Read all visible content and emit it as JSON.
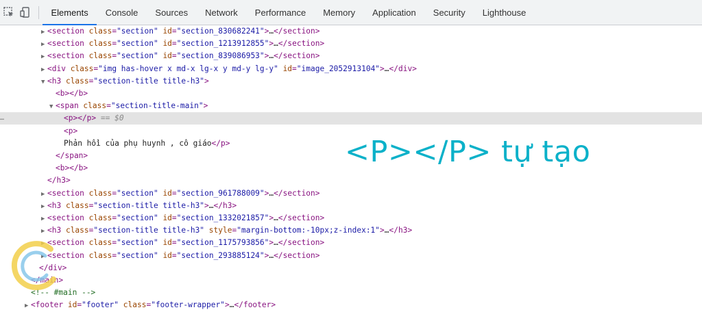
{
  "toolbar": {
    "tabs": [
      {
        "label": "Elements",
        "active": true
      },
      {
        "label": "Console"
      },
      {
        "label": "Sources"
      },
      {
        "label": "Network"
      },
      {
        "label": "Performance"
      },
      {
        "label": "Memory"
      },
      {
        "label": "Application"
      },
      {
        "label": "Security"
      },
      {
        "label": "Lighthouse"
      }
    ]
  },
  "tree": {
    "rows": [
      {
        "indent": 0,
        "arrow": "▶",
        "parts": [
          [
            "tag",
            "<section "
          ],
          [
            "attr",
            "class"
          ],
          [
            "tag",
            "="
          ],
          [
            "val",
            "\"section\""
          ],
          [
            "tag",
            " "
          ],
          [
            "attr",
            "id"
          ],
          [
            "tag",
            "="
          ],
          [
            "val",
            "\"section_830682241\""
          ],
          [
            "tag",
            ">"
          ],
          [
            "ell",
            "…"
          ],
          [
            "tag",
            "</section>"
          ]
        ]
      },
      {
        "indent": 0,
        "arrow": "▶",
        "parts": [
          [
            "tag",
            "<section "
          ],
          [
            "attr",
            "class"
          ],
          [
            "tag",
            "="
          ],
          [
            "val",
            "\"section\""
          ],
          [
            "tag",
            " "
          ],
          [
            "attr",
            "id"
          ],
          [
            "tag",
            "="
          ],
          [
            "val",
            "\"section_1213912855\""
          ],
          [
            "tag",
            ">"
          ],
          [
            "ell",
            "…"
          ],
          [
            "tag",
            "</section>"
          ]
        ]
      },
      {
        "indent": 0,
        "arrow": "▶",
        "parts": [
          [
            "tag",
            "<section "
          ],
          [
            "attr",
            "class"
          ],
          [
            "tag",
            "="
          ],
          [
            "val",
            "\"section\""
          ],
          [
            "tag",
            " "
          ],
          [
            "attr",
            "id"
          ],
          [
            "tag",
            "="
          ],
          [
            "val",
            "\"section_839086953\""
          ],
          [
            "tag",
            ">"
          ],
          [
            "ell",
            "…"
          ],
          [
            "tag",
            "</section>"
          ]
        ]
      },
      {
        "indent": 0,
        "arrow": "▶",
        "parts": [
          [
            "tag",
            "<div "
          ],
          [
            "attr",
            "class"
          ],
          [
            "tag",
            "="
          ],
          [
            "val",
            "\"img has-hover x md-x lg-x y md-y lg-y\""
          ],
          [
            "tag",
            " "
          ],
          [
            "attr",
            "id"
          ],
          [
            "tag",
            "="
          ],
          [
            "val",
            "\"image_2052913104\""
          ],
          [
            "tag",
            ">"
          ],
          [
            "ell",
            "…"
          ],
          [
            "tag",
            "</div>"
          ]
        ]
      },
      {
        "indent": 0,
        "arrow": "▼",
        "parts": [
          [
            "tag",
            "<h3 "
          ],
          [
            "attr",
            "class"
          ],
          [
            "tag",
            "="
          ],
          [
            "val",
            "\"section-title title-h3\""
          ],
          [
            "tag",
            ">"
          ]
        ]
      },
      {
        "indent": 1,
        "arrow": "",
        "parts": [
          [
            "tag",
            "<b></b>"
          ]
        ]
      },
      {
        "indent": 1,
        "arrow": "▼",
        "parts": [
          [
            "tag",
            "<span "
          ],
          [
            "attr",
            "class"
          ],
          [
            "tag",
            "="
          ],
          [
            "val",
            "\"section-title-main\""
          ],
          [
            "tag",
            ">"
          ]
        ]
      },
      {
        "indent": 2,
        "arrow": "",
        "selected": true,
        "parts": [
          [
            "tag",
            "<p></p>"
          ],
          [
            "eq0",
            " == $0"
          ]
        ]
      },
      {
        "indent": 2,
        "arrow": "",
        "parts": [
          [
            "tag",
            "<p>"
          ]
        ]
      },
      {
        "indent": 2,
        "arrow": "",
        "parts": [
          [
            "txt",
            "Phản hồi của phụ huynh , cô giáo"
          ],
          [
            "tag",
            "</p>"
          ]
        ]
      },
      {
        "indent": 1,
        "arrow": "",
        "parts": [
          [
            "tag",
            "</span>"
          ]
        ]
      },
      {
        "indent": 1,
        "arrow": "",
        "parts": [
          [
            "tag",
            "<b></b>"
          ]
        ]
      },
      {
        "indent": 0,
        "arrow": "",
        "parts": [
          [
            "tag",
            "</h3>"
          ]
        ]
      },
      {
        "indent": 0,
        "arrow": "▶",
        "parts": [
          [
            "tag",
            "<section "
          ],
          [
            "attr",
            "class"
          ],
          [
            "tag",
            "="
          ],
          [
            "val",
            "\"section\""
          ],
          [
            "tag",
            " "
          ],
          [
            "attr",
            "id"
          ],
          [
            "tag",
            "="
          ],
          [
            "val",
            "\"section_961788009\""
          ],
          [
            "tag",
            ">"
          ],
          [
            "ell",
            "…"
          ],
          [
            "tag",
            "</section>"
          ]
        ]
      },
      {
        "indent": 0,
        "arrow": "▶",
        "parts": [
          [
            "tag",
            "<h3 "
          ],
          [
            "attr",
            "class"
          ],
          [
            "tag",
            "="
          ],
          [
            "val",
            "\"section-title title-h3\""
          ],
          [
            "tag",
            ">"
          ],
          [
            "ell",
            "…"
          ],
          [
            "tag",
            "</h3>"
          ]
        ]
      },
      {
        "indent": 0,
        "arrow": "▶",
        "parts": [
          [
            "tag",
            "<section "
          ],
          [
            "attr",
            "class"
          ],
          [
            "tag",
            "="
          ],
          [
            "val",
            "\"section\""
          ],
          [
            "tag",
            " "
          ],
          [
            "attr",
            "id"
          ],
          [
            "tag",
            "="
          ],
          [
            "val",
            "\"section_1332021857\""
          ],
          [
            "tag",
            ">"
          ],
          [
            "ell",
            "…"
          ],
          [
            "tag",
            "</section>"
          ]
        ]
      },
      {
        "indent": 0,
        "arrow": "▶",
        "parts": [
          [
            "tag",
            "<h3 "
          ],
          [
            "attr",
            "class"
          ],
          [
            "tag",
            "="
          ],
          [
            "val",
            "\"section-title title-h3\""
          ],
          [
            "tag",
            " "
          ],
          [
            "attr",
            "style"
          ],
          [
            "tag",
            "="
          ],
          [
            "val",
            "\"margin-bottom:-10px;z-index:1\""
          ],
          [
            "tag",
            ">"
          ],
          [
            "ell",
            "…"
          ],
          [
            "tag",
            "</h3>"
          ]
        ]
      },
      {
        "indent": 0,
        "arrow": "▶",
        "parts": [
          [
            "tag",
            "<section "
          ],
          [
            "attr",
            "class"
          ],
          [
            "tag",
            "="
          ],
          [
            "val",
            "\"section\""
          ],
          [
            "tag",
            " "
          ],
          [
            "attr",
            "id"
          ],
          [
            "tag",
            "="
          ],
          [
            "val",
            "\"section_1175793856\""
          ],
          [
            "tag",
            ">"
          ],
          [
            "ell",
            "…"
          ],
          [
            "tag",
            "</section>"
          ]
        ]
      },
      {
        "indent": 0,
        "arrow": "▶",
        "parts": [
          [
            "tag",
            "<section "
          ],
          [
            "attr",
            "class"
          ],
          [
            "tag",
            "="
          ],
          [
            "val",
            "\"section\""
          ],
          [
            "tag",
            " "
          ],
          [
            "attr",
            "id"
          ],
          [
            "tag",
            "="
          ],
          [
            "val",
            "\"section_293885124\""
          ],
          [
            "tag",
            ">"
          ],
          [
            "ell",
            "…"
          ],
          [
            "tag",
            "</section>"
          ]
        ]
      },
      {
        "indent": -1,
        "arrow": "",
        "parts": [
          [
            "tag",
            "</div>"
          ]
        ]
      },
      {
        "indent": -2,
        "arrow": "",
        "parts": [
          [
            "tag",
            "</main>"
          ]
        ]
      },
      {
        "indent": -2,
        "arrow": "",
        "parts": [
          [
            "cmt",
            "<!-- #main -->"
          ]
        ]
      },
      {
        "indent": -2,
        "arrow": "▶",
        "parts": [
          [
            "tag",
            "<footer "
          ],
          [
            "attr",
            "id"
          ],
          [
            "tag",
            "="
          ],
          [
            "val",
            "\"footer\""
          ],
          [
            "tag",
            " "
          ],
          [
            "attr",
            "class"
          ],
          [
            "tag",
            "="
          ],
          [
            "val",
            "\"footer-wrapper\""
          ],
          [
            "tag",
            ">"
          ],
          [
            "ell",
            "…"
          ],
          [
            "tag",
            "</footer>"
          ]
        ]
      }
    ]
  },
  "annotation": {
    "text": "<P></P> tự tạo",
    "color": "#0ab1c9"
  }
}
